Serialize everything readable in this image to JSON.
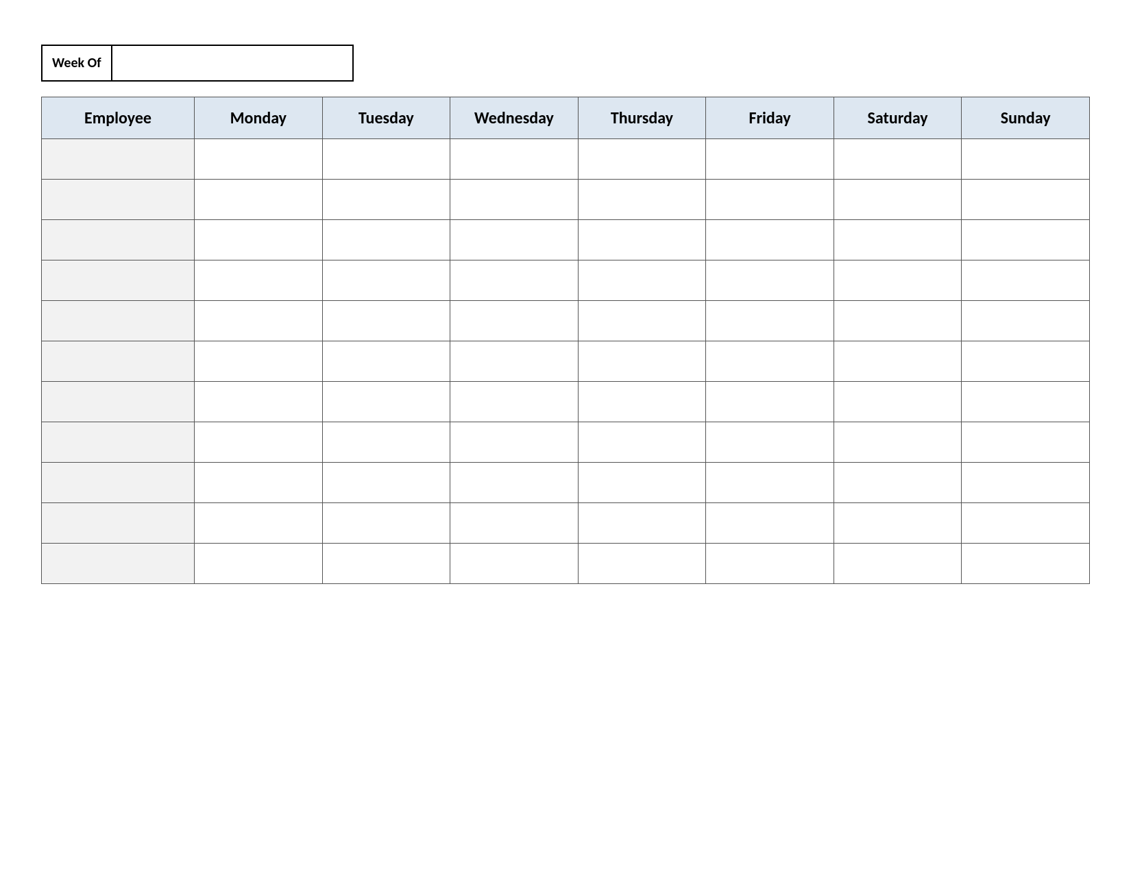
{
  "week_of_label": "Week Of",
  "week_of_value": "",
  "headers": {
    "employee": "Employee",
    "days": [
      "Monday",
      "Tuesday",
      "Wednesday",
      "Thursday",
      "Friday",
      "Saturday",
      "Sunday"
    ]
  },
  "rows": [
    {
      "employee": "",
      "cells": [
        "",
        "",
        "",
        "",
        "",
        "",
        ""
      ]
    },
    {
      "employee": "",
      "cells": [
        "",
        "",
        "",
        "",
        "",
        "",
        ""
      ]
    },
    {
      "employee": "",
      "cells": [
        "",
        "",
        "",
        "",
        "",
        "",
        ""
      ]
    },
    {
      "employee": "",
      "cells": [
        "",
        "",
        "",
        "",
        "",
        "",
        ""
      ]
    },
    {
      "employee": "",
      "cells": [
        "",
        "",
        "",
        "",
        "",
        "",
        ""
      ]
    },
    {
      "employee": "",
      "cells": [
        "",
        "",
        "",
        "",
        "",
        "",
        ""
      ]
    },
    {
      "employee": "",
      "cells": [
        "",
        "",
        "",
        "",
        "",
        "",
        ""
      ]
    },
    {
      "employee": "",
      "cells": [
        "",
        "",
        "",
        "",
        "",
        "",
        ""
      ]
    },
    {
      "employee": "",
      "cells": [
        "",
        "",
        "",
        "",
        "",
        "",
        ""
      ]
    },
    {
      "employee": "",
      "cells": [
        "",
        "",
        "",
        "",
        "",
        "",
        ""
      ]
    },
    {
      "employee": "",
      "cells": [
        "",
        "",
        "",
        "",
        "",
        "",
        ""
      ]
    }
  ]
}
